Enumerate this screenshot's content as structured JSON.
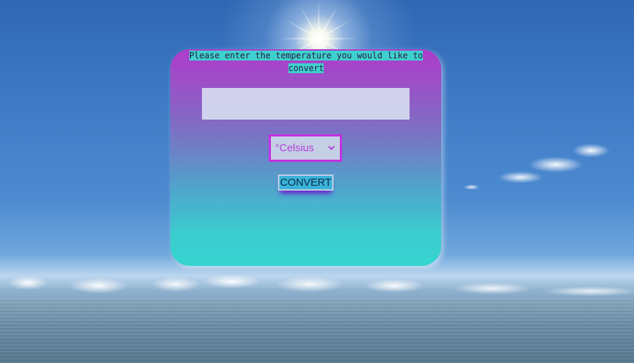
{
  "converter": {
    "prompt": "Please enter the temperature you would like to convert",
    "input_value": "",
    "unit_select": {
      "selected": "°Celsius"
    },
    "convert_label": "CONVERT"
  },
  "icons": {
    "select_arrow": "chevron-down-icon"
  },
  "colors": {
    "card_top": "#ae3ccb",
    "card_bottom": "#35d5cf",
    "prompt_highlight": "#3ed0cf",
    "select_border": "#c52ee0",
    "select_text": "#b43fd6",
    "button_bg": "#3ab3d8",
    "button_shadow": "#6b1dcc"
  }
}
